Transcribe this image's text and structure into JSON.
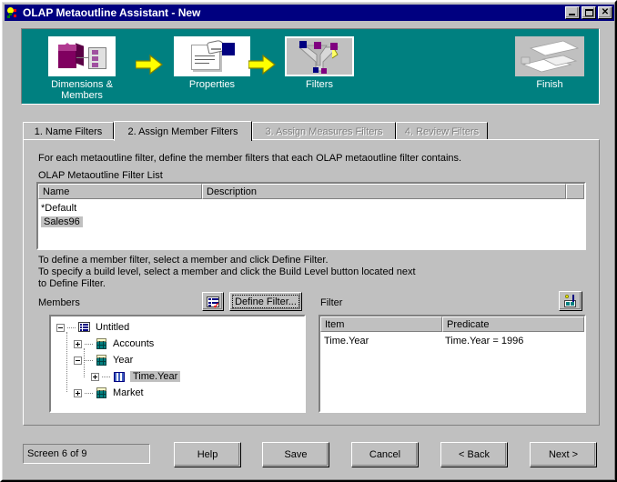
{
  "window": {
    "title": "OLAP Metaoutline Assistant - New",
    "icon": "olap-app-icon",
    "buttons": [
      {
        "name": "minimize",
        "glyph": "minimize-icon"
      },
      {
        "name": "maximize",
        "glyph": "maximize-icon"
      },
      {
        "name": "close",
        "glyph": "close-icon",
        "label": "✕"
      }
    ]
  },
  "banner": {
    "background_color": "#008080",
    "steps": [
      {
        "label": "Dimensions &\nMembers",
        "label_line1": "Dimensions &",
        "label_line2": "Members",
        "icon": "cube-members-icon",
        "selected": false
      },
      {
        "label": "Properties",
        "label_line1": "Properties",
        "label_line2": "",
        "icon": "properties-document-icon",
        "selected": false
      },
      {
        "label": "Filters",
        "label_line1": "Filters",
        "label_line2": "",
        "icon": "filters-funnel-icon",
        "selected": true
      },
      {
        "label": "Finish",
        "label_line1": "Finish",
        "label_line2": "",
        "icon": "finish-sheets-icon",
        "selected": false
      }
    ],
    "arrows": [
      {
        "name": "arrow-1",
        "color": "#ffff00"
      },
      {
        "name": "arrow-2",
        "color": "#ffff00"
      }
    ]
  },
  "tabs": [
    {
      "label": "1. Name Filters",
      "state": "enabled"
    },
    {
      "label": "2. Assign Member Filters",
      "state": "active"
    },
    {
      "label": "3. Assign Measures Filters",
      "state": "disabled"
    },
    {
      "label": "4. Review Filters",
      "state": "disabled"
    }
  ],
  "panel": {
    "instruction": "For each metaoutline filter, define the member filters that each OLAP metaoutline filter contains.",
    "filter_list_label": "OLAP Metaoutline Filter List",
    "filter_list": {
      "columns": [
        "Name",
        "Description"
      ],
      "rows": [
        {
          "name": "*Default",
          "description": "",
          "selected": false
        },
        {
          "name": "Sales96",
          "description": "",
          "selected": true
        }
      ]
    },
    "hint_line1": "To define a member filter, select a member and click Define Filter.",
    "hint_line2": "To specify a build level, select a member and click the Build Level button located next",
    "hint_line3": "to Define Filter.",
    "members": {
      "label": "Members",
      "build_level_button": "build-level-icon",
      "define_filter_button": "Define Filter...",
      "define_filter_accesskey": "F",
      "tree": [
        {
          "label": "Untitled",
          "level": 0,
          "expander": "minus",
          "icon": "outline-icon",
          "selected": false
        },
        {
          "label": "Accounts",
          "level": 1,
          "expander": "plus",
          "icon": "dimension-cube-icon",
          "selected": false
        },
        {
          "label": "Year",
          "level": 1,
          "expander": "minus",
          "icon": "dimension-cube-icon",
          "selected": false
        },
        {
          "label": "Time.Year",
          "level": 2,
          "expander": "plus",
          "icon": "member-table-icon",
          "selected": true
        },
        {
          "label": "Market",
          "level": 1,
          "expander": "plus",
          "icon": "dimension-cube-icon",
          "selected": false
        }
      ]
    },
    "filter": {
      "label": "Filter",
      "edit_button": "edit-filter-icon",
      "columns": [
        "Item",
        "Predicate"
      ],
      "rows": [
        {
          "item": "Time.Year",
          "predicate": "Time.Year = 1996"
        }
      ]
    }
  },
  "footer": {
    "status": "Screen 6 of 9",
    "buttons": [
      {
        "label": "Help",
        "accesskey": "",
        "name": "help-button"
      },
      {
        "label": "Save",
        "accesskey": "S",
        "name": "save-button"
      },
      {
        "label": "Cancel",
        "accesskey": "",
        "name": "cancel-button"
      },
      {
        "label": "< Back",
        "accesskey": "B",
        "name": "back-button"
      },
      {
        "label": "Next >",
        "accesskey": "N",
        "name": "next-button"
      }
    ]
  }
}
